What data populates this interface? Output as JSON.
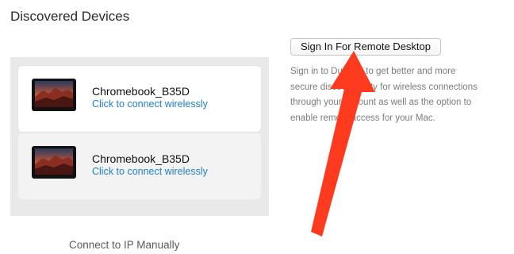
{
  "section_title": "Discovered Devices",
  "devices": [
    {
      "name": "Chromebook_B35D",
      "action": "Click to connect wirelessly"
    },
    {
      "name": "Chromebook_B35D",
      "action": "Click to connect wirelessly"
    }
  ],
  "connect_ip_label": "Connect to IP Manually",
  "signin": {
    "button_label": "Sign In For Remote Desktop",
    "description": "Sign in to Duet Air to get better and more secure discoverability for wireless connections through your account as well as the option to enable remote access for your Mac."
  },
  "colors": {
    "link": "#1f7fd1",
    "panel": "#e9e9e9",
    "annotation_arrow": "#ff3b1f"
  },
  "icons": {
    "device_thumbnail": "laptop-screen-icon",
    "annotation": "red-arrow-icon"
  }
}
